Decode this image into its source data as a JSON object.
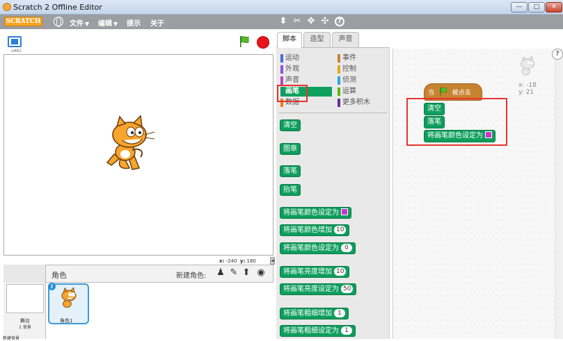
{
  "window": {
    "title": "Scratch 2 Offline Editor",
    "min": "—",
    "max": "□",
    "close": "✕"
  },
  "menubar": {
    "logo": "SCRATCH",
    "items": [
      {
        "label": "文件",
        "caret": "▼"
      },
      {
        "label": "编辑",
        "caret": "▼"
      },
      {
        "label": "提示",
        "caret": ""
      },
      {
        "label": "关于",
        "caret": ""
      }
    ],
    "tools": [
      "duplicate-icon",
      "delete-icon",
      "grow-icon",
      "shrink-icon",
      "help-icon"
    ]
  },
  "stage": {
    "version": "v461",
    "coords_x_label": "x:",
    "coords_x": "-240",
    "coords_y_label": "y:",
    "coords_y": "180"
  },
  "sprites": {
    "header_label": "角色",
    "new_sprite_label": "新建角色:",
    "stage_label": "舞台",
    "stage_backdrops": "1 背景",
    "new_backdrop": "新建背景",
    "sprite1_name": "角色1"
  },
  "tabs": [
    "脚本",
    "造型",
    "声音"
  ],
  "categories": [
    {
      "label": "运动",
      "color": "#4a6cd4"
    },
    {
      "label": "事件",
      "color": "#c88330"
    },
    {
      "label": "外观",
      "color": "#8a55d7"
    },
    {
      "label": "控制",
      "color": "#e1a91a"
    },
    {
      "label": "声音",
      "color": "#bb42c3"
    },
    {
      "label": "侦测",
      "color": "#2ca5e2"
    },
    {
      "label": "画笔",
      "color": "#0e9a6c"
    },
    {
      "label": "运算",
      "color": "#5cb712"
    },
    {
      "label": "数据",
      "color": "#ee7d16"
    },
    {
      "label": "更多积木",
      "color": "#632d99"
    }
  ],
  "pen_blocks": [
    {
      "label": "清空"
    },
    {
      "label": "图章"
    },
    {
      "label": "落笔"
    },
    {
      "label": "抬笔"
    },
    {
      "label": "将画笔颜色设定为",
      "swatch": "#cc33cc"
    },
    {
      "label": "将画笔颜色增加",
      "value": "10"
    },
    {
      "label": "将画笔颜色设定为",
      "value": "0"
    },
    {
      "label": "将画笔亮度增加",
      "value": "10"
    },
    {
      "label": "将画笔亮度设定为",
      "value": "50"
    },
    {
      "label": "将画笔粗细增加",
      "value": "1"
    },
    {
      "label": "将画笔粗细设定为",
      "value": "1"
    }
  ],
  "script": {
    "hat_when": "当",
    "hat_clicked": "被点击",
    "blocks": [
      "清空",
      "落笔",
      "将画笔颜色设定为"
    ],
    "sprite_x": "x: -18",
    "sprite_y": "y: 21",
    "help": "?"
  },
  "colors": {
    "pen": "#0e9e5d",
    "event": "#c88330",
    "highlight": "#e8332d",
    "swatch": "#cc33cc"
  }
}
